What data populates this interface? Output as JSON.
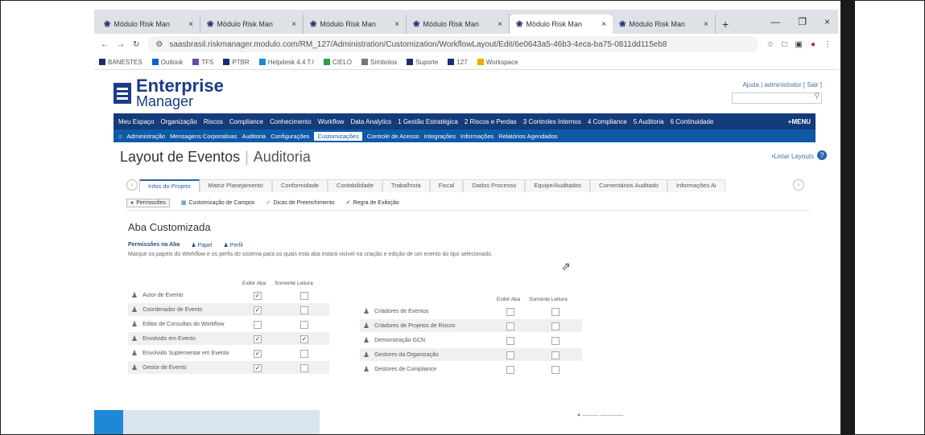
{
  "browser": {
    "tabs": [
      {
        "label": "Módulo Risk Man"
      },
      {
        "label": "Módulo Risk Man"
      },
      {
        "label": "Módulo Risk Man"
      },
      {
        "label": "Módulo Risk Man"
      },
      {
        "label": "Módulo Risk Man",
        "active": true
      },
      {
        "label": "Módulo Risk Man"
      }
    ],
    "url": "saasbrasil.riskmanager.modulo.com/RM_127/Administration/Customization/WorkflowLayout/Edit/6e0643a5-46b3-4eca-ba75-0811dd115eb8",
    "bookmarks": [
      "BANESTES",
      "Outlook",
      "TFS",
      "PTBR",
      "Helpdesk 4.4 T.I",
      "CIELO",
      "Símbolos",
      "Suporte",
      "127",
      "Workspace"
    ]
  },
  "app": {
    "logo_line1": "Enterprise",
    "logo_line2": "Manager",
    "help_links": "Ajuda  |  administrator [ Sair ]",
    "nav1": [
      "Meu Espaço",
      "Organização",
      "Riscos",
      "Compliance",
      "Conhecimento",
      "Workflow",
      "Data Analytics",
      "1 Gestão Estratégica",
      "2 Riscos e Perdas",
      "3 Controles Internos",
      "4 Compliance",
      "5 Auditoria",
      "6 Continuidade"
    ],
    "nav1_more": "+MENU",
    "nav2": [
      "Administração",
      "Mensagens Corporativas",
      "Auditoria",
      "Configurações",
      "Customizações",
      "Controle de Acesso",
      "Integrações",
      "Informações",
      "Relatórios Agendados"
    ],
    "nav2_selected": "Customizações",
    "page_title": "Layout de Eventos",
    "page_subtitle": "Auditoria",
    "list_link": "•Listar Layouts",
    "tabs": [
      "Infos do Projeto",
      "Matriz Planejamento",
      "Conformidade",
      "Contabilidade",
      "Trabalhista",
      "Fiscal",
      "Dados Processo",
      "Equipe/Auditados",
      "Comentários Auditado",
      "Informações Ai"
    ],
    "toolbar": [
      "Permissões",
      "Customização de Campos",
      "Dicas de Preenchimento",
      "Regra de Exibição"
    ],
    "section_title": "Aba Customizada",
    "perm_label": "Permissões na Aba",
    "perm_papel": "Papel",
    "perm_perfil": "Perfil",
    "description": "Marque os papéis do Workflow e os perfis do sistema para os quais esta aba estará visível na criação e edição de um evento do tipo selecionado.",
    "col_exibir": "Exibir Aba",
    "col_leitura": "Somente Leitura",
    "roles_left": [
      {
        "name": "Autor de Evento",
        "exibir": true,
        "leitura": false
      },
      {
        "name": "Coordenador de Evento",
        "exibir": true,
        "leitura": false
      },
      {
        "name": "Editor de Consultas do Workflow",
        "exibir": false,
        "leitura": false
      },
      {
        "name": "Envolvido em Evento",
        "exibir": true,
        "leitura": true
      },
      {
        "name": "Envolvido Suplementar em Evento",
        "exibir": true,
        "leitura": false
      },
      {
        "name": "Gestor de Evento",
        "exibir": true,
        "leitura": false
      }
    ],
    "roles_right": [
      {
        "name": "Criadores de Eventos",
        "exibir": false,
        "leitura": false
      },
      {
        "name": "Criadores de Projetos de Riscos",
        "exibir": false,
        "leitura": false
      },
      {
        "name": "Demonstração GCN",
        "exibir": false,
        "leitura": false
      },
      {
        "name": "Gestores da Organização",
        "exibir": false,
        "leitura": false
      },
      {
        "name": "Gestores de Compliance",
        "exibir": false,
        "leitura": false
      }
    ]
  }
}
